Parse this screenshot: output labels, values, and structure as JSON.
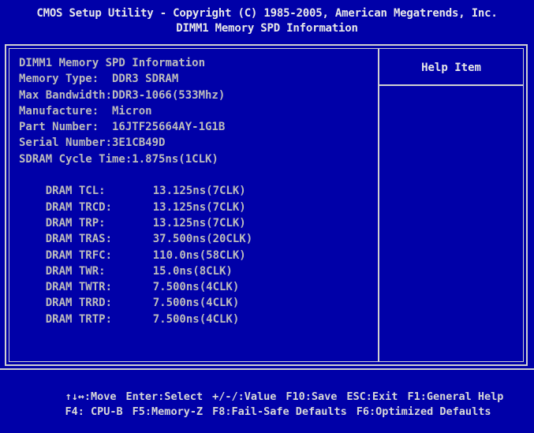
{
  "title": {
    "line1": "CMOS Setup Utility - Copyright (C) 1985-2005, American Megatrends, Inc.",
    "line2": "DIMM1 Memory SPD Information"
  },
  "panel": {
    "heading": "DIMM1 Memory SPD Information",
    "fields": [
      "Memory Type:  DDR3 SDRAM",
      "Max Bandwidth:DDR3-1066(533Mhz)",
      "Manufacture:  Micron",
      "Part Number:  16JTF25664AY-1G1B",
      "Serial Number:3E1CB49D",
      "SDRAM Cycle Time:1.875ns(1CLK)"
    ],
    "timings": [
      {
        "label": "DRAM TCL:",
        "value": "13.125ns(7CLK)"
      },
      {
        "label": "DRAM TRCD:",
        "value": "13.125ns(7CLK)"
      },
      {
        "label": "DRAM TRP:",
        "value": "13.125ns(7CLK)"
      },
      {
        "label": "DRAM TRAS:",
        "value": "37.500ns(20CLK)"
      },
      {
        "label": "DRAM TRFC:",
        "value": "110.0ns(58CLK)"
      },
      {
        "label": "DRAM TWR:",
        "value": "15.0ns(8CLK)"
      },
      {
        "label": "DRAM TWTR:",
        "value": "7.500ns(4CLK)"
      },
      {
        "label": "DRAM TRRD:",
        "value": "7.500ns(4CLK)"
      },
      {
        "label": "DRAM TRTP:",
        "value": "7.500ns(4CLK)"
      }
    ]
  },
  "help": {
    "title": "Help Item"
  },
  "keys": {
    "row1": [
      "↑↓↔:Move",
      "Enter:Select",
      "+/-/:Value",
      "F10:Save",
      "ESC:Exit",
      "F1:General Help"
    ],
    "row2": [
      "F4: CPU-B",
      "F5:Memory-Z",
      "F8:Fail-Safe Defaults",
      "F6:Optimized Defaults"
    ]
  },
  "colors": {
    "background": "#0000a8",
    "text": "#d0d0d0"
  }
}
